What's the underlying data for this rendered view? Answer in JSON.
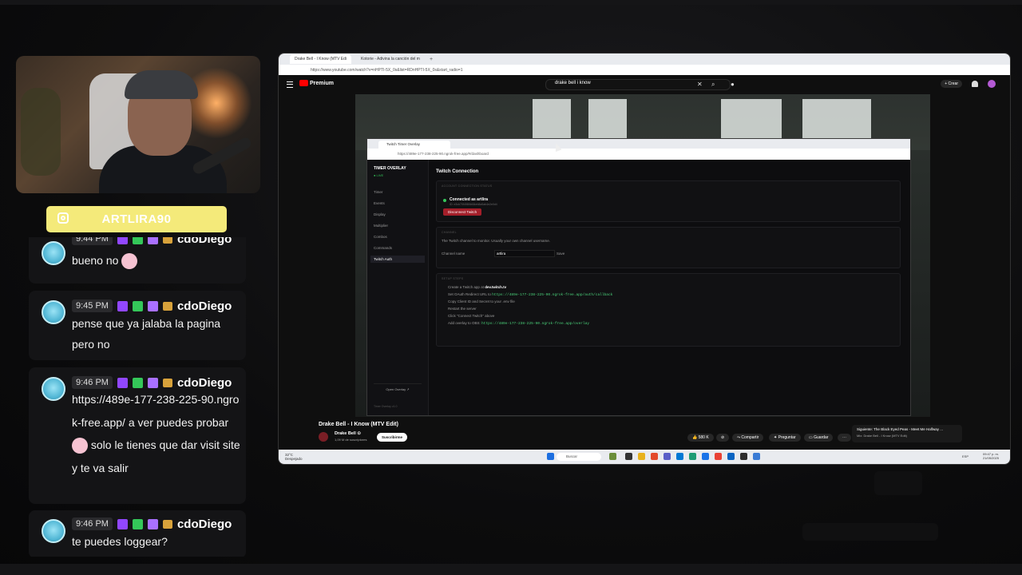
{
  "instagram": {
    "handle": "ARTLIRA90",
    "icon": "instagram-icon"
  },
  "chat": {
    "messages": [
      {
        "time": "9:44 PM",
        "user": "cdoDiego",
        "text": "bueno no",
        "emote": true
      },
      {
        "time": "9:45 PM",
        "user": "cdoDiego",
        "text": "pense que ya jalaba la pagina pero no"
      },
      {
        "time": "9:46 PM",
        "user": "cdoDiego",
        "text_a": "https://489e-177-238-225-90.ngrok-free.app/ a ver puedes probar",
        "text_b": "solo le tienes que dar visit site y te va salir"
      },
      {
        "time": "9:46 PM",
        "user": "cdoDiego",
        "text": "te puedes loggear?"
      }
    ]
  },
  "browser": {
    "tabs": [
      "Drake Bell - I Know (MTV Edi",
      "Kotorie - Adivina la canción del m"
    ],
    "url": "https://www.youtube.com/watch?v=nHPTI-5X_0s&list=RDnHPTI-5X_0s&start_radio=1",
    "youtube": {
      "logo": "Premium",
      "search": "drake bell i know",
      "create": "+ Crear"
    }
  },
  "overlay_app": {
    "tab": "Twitch Timer Overlay",
    "url": "https://489e-177-238-225-90.ngrok-free.app/#/dashboard",
    "brand": "TIMER OVERLAY",
    "status": "● LIVE",
    "nav": [
      "Timer",
      "Events",
      "Display",
      "Multiplier",
      "Combos",
      "Commands",
      "Twitch Auth"
    ],
    "open_overlay": "Open Overlay ↗",
    "footer": "Timer Overlay v1.0",
    "heading": "Twitch Connection",
    "account_label": "ACCOUNT CONNECTION STATUS",
    "connected": "Connected as artlira",
    "connected_sub": "ID: e3cb70f498f4b54eb8a9ab4e2e0d4",
    "disconnect": "Disconnect Twitch",
    "channel_label": "CHANNEL",
    "channel_desc": "The Twitch channel to monitor. Usually your own channel username.",
    "channel_field": "Channel name",
    "channel_value": "artlira",
    "save": "Save",
    "setup_label": "SETUP STEPS",
    "steps": {
      "s1_a": "Create a Twitch app at",
      "s1_b": "dev.twitch.tv",
      "s2_a": "Set OAuth Redirect URL to",
      "s2_b": "https://489e-177-238-225-90.ngrok-free.app/auth/callback",
      "s3": "Copy Client ID and Secret to your .env file",
      "s4": "Restart the server",
      "s5": "Click \"Connect Twitch\" above",
      "s6_a": "Add overlay to OBS:",
      "s6_b": "https://489e-177-238-225-90.ngrok-free.app/overlay"
    }
  },
  "video_info": {
    "title": "Drake Bell - I Know (MTV Edit)",
    "channel": "Drake Bell ⊙",
    "subs": "1,09 M de suscriptores",
    "subscribe": "Suscribirme",
    "likes": "580 K",
    "share": "Compartir",
    "ask": "Preguntar",
    "save": "Guardar",
    "next_1": "Siguiente: The Black Eyed Peas - Meet Me Halfway ...",
    "next_2": "Mix: Drake Bell - I Know (MTV Edit)"
  },
  "taskbar": {
    "weather_1": "32°C",
    "weather_2": "Despejado",
    "search": "Buscar",
    "lang": "ESP",
    "time": "09:47 p. m.",
    "date": "21/05/2025"
  },
  "colors": {
    "ig_bar": "#f4ea7a",
    "yt_red": "#ff0000",
    "twitch_purple": "#9147ff",
    "ngrok_green": "#4ad17a",
    "disconnect_red": "#a41f2a"
  }
}
